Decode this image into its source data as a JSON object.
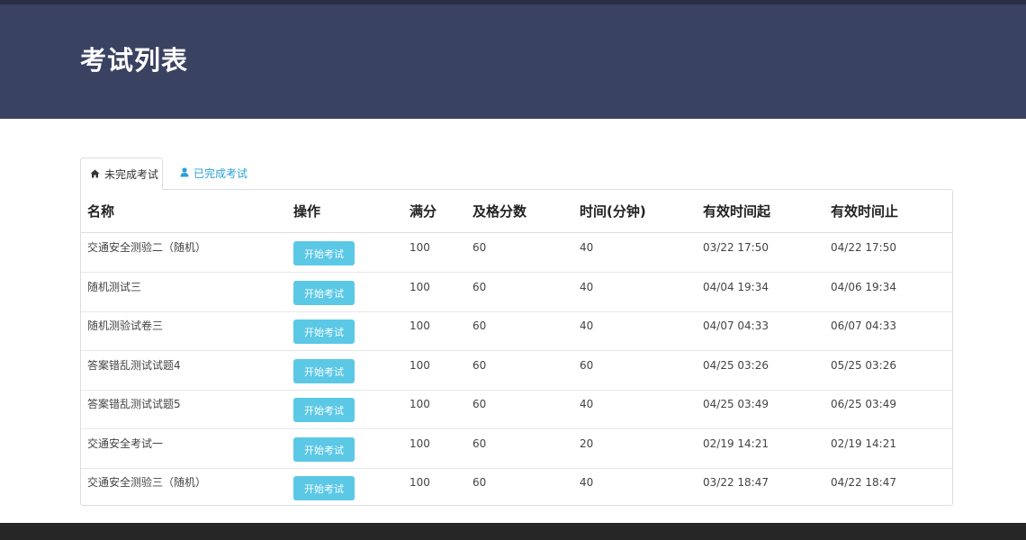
{
  "page": {
    "title": "考试列表"
  },
  "tabs": [
    {
      "label": "未完成考试",
      "icon": "home-icon",
      "active": true
    },
    {
      "label": "已完成考试",
      "icon": "user-icon",
      "active": false
    }
  ],
  "table": {
    "headers": [
      "名称",
      "操作",
      "满分",
      "及格分数",
      "时间(分钟)",
      "有效时间起",
      "有效时间止"
    ],
    "action_label": "开始考试",
    "rows": [
      {
        "name": "交通安全测验二（随机）",
        "full_score": "100",
        "pass_score": "60",
        "duration": "40",
        "start": "03/22 17:50",
        "end": "04/22 17:50"
      },
      {
        "name": "随机测试三",
        "full_score": "100",
        "pass_score": "60",
        "duration": "40",
        "start": "04/04 19:34",
        "end": "04/06 19:34"
      },
      {
        "name": "随机测验试卷三",
        "full_score": "100",
        "pass_score": "60",
        "duration": "40",
        "start": "04/07 04:33",
        "end": "06/07 04:33"
      },
      {
        "name": "答案错乱测试试题4",
        "full_score": "100",
        "pass_score": "60",
        "duration": "60",
        "start": "04/25 03:26",
        "end": "05/25 03:26"
      },
      {
        "name": "答案错乱测试试题5",
        "full_score": "100",
        "pass_score": "60",
        "duration": "40",
        "start": "04/25 03:49",
        "end": "06/25 03:49"
      },
      {
        "name": "交通安全考试一",
        "full_score": "100",
        "pass_score": "60",
        "duration": "20",
        "start": "02/19 14:21",
        "end": "02/19 14:21"
      },
      {
        "name": "交通安全测验三（随机）",
        "full_score": "100",
        "pass_score": "60",
        "duration": "40",
        "start": "03/22 18:47",
        "end": "04/22 18:47"
      }
    ]
  },
  "colors": {
    "banner": "#3a4262",
    "button": "#5bc8e6",
    "tab_link": "#2aa0d6",
    "footer": "#262626"
  }
}
